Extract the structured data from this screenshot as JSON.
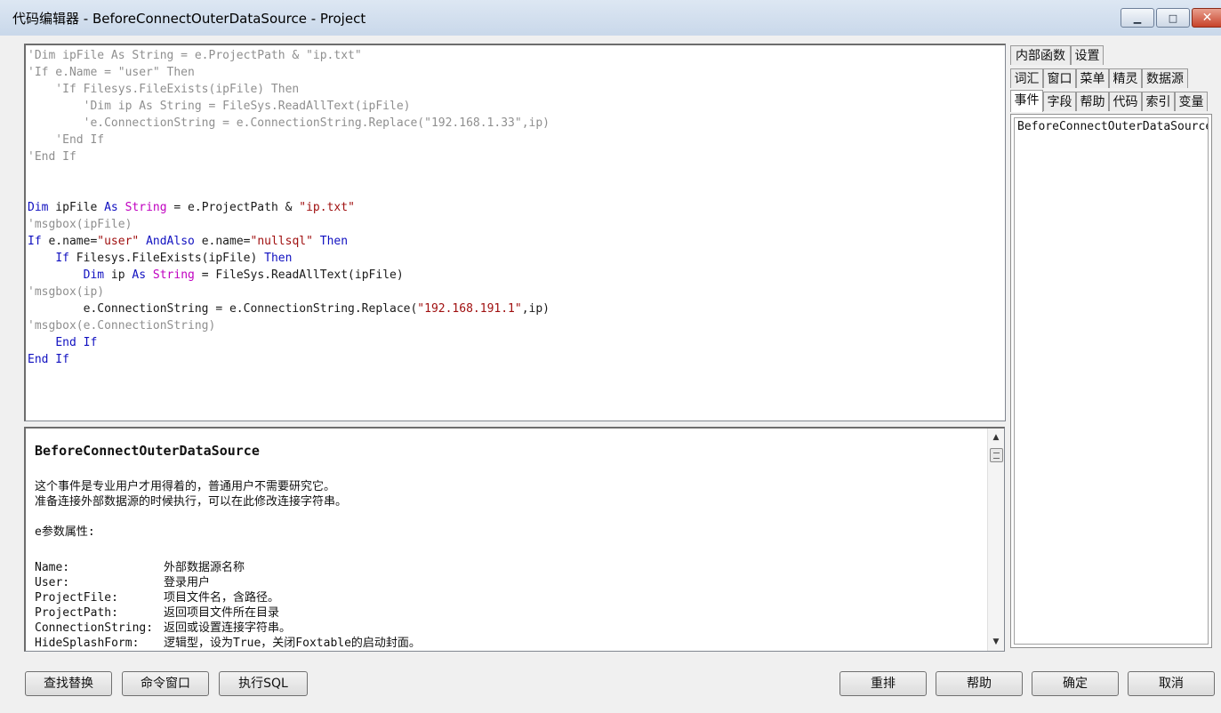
{
  "window": {
    "title": "代码编辑器 - BeforeConnectOuterDataSource - Project",
    "minimize_glyph": "▁",
    "maximize_glyph": "□",
    "close_glyph": "✕"
  },
  "code": [
    [
      [
        "c-cm",
        "'Dim ipFile As String = e.ProjectPath & \"ip.txt\""
      ]
    ],
    [
      [
        "c-cm",
        "'If e.Name = \"user\" Then"
      ]
    ],
    [
      [
        "c-cm",
        "    'If Filesys.FileExists(ipFile) Then"
      ]
    ],
    [
      [
        "c-cm",
        "        'Dim ip As String = FileSys.ReadAllText(ipFile)"
      ]
    ],
    [
      [
        "c-cm",
        "        'e.ConnectionString = e.ConnectionString.Replace(\"192.168.1.33\",ip)"
      ]
    ],
    [
      [
        "c-cm",
        "    'End If"
      ]
    ],
    [
      [
        "c-cm",
        "'End If"
      ]
    ],
    [],
    [],
    [
      [
        "c-kw",
        "Dim"
      ],
      [
        "c-tx",
        " ipFile "
      ],
      [
        "c-kw",
        "As"
      ],
      [
        "c-tx",
        " "
      ],
      [
        "c-ty",
        "String"
      ],
      [
        "c-tx",
        " = e.ProjectPath & "
      ],
      [
        "c-st",
        "\"ip.txt\""
      ]
    ],
    [
      [
        "c-cm",
        "'msgbox(ipFile)"
      ]
    ],
    [
      [
        "c-kw",
        "If"
      ],
      [
        "c-tx",
        " e.name="
      ],
      [
        "c-st",
        "\"user\""
      ],
      [
        "c-tx",
        " "
      ],
      [
        "c-kw",
        "AndAlso"
      ],
      [
        "c-tx",
        " e.name="
      ],
      [
        "c-st",
        "\"nullsql\""
      ],
      [
        "c-tx",
        " "
      ],
      [
        "c-kw",
        "Then"
      ]
    ],
    [
      [
        "c-tx",
        "    "
      ],
      [
        "c-kw",
        "If"
      ],
      [
        "c-tx",
        " Filesys.FileExists(ipFile) "
      ],
      [
        "c-kw",
        "Then"
      ]
    ],
    [
      [
        "c-tx",
        "        "
      ],
      [
        "c-kw",
        "Dim"
      ],
      [
        "c-tx",
        " ip "
      ],
      [
        "c-kw",
        "As"
      ],
      [
        "c-tx",
        " "
      ],
      [
        "c-ty",
        "String"
      ],
      [
        "c-tx",
        " = FileSys.ReadAllText(ipFile)"
      ]
    ],
    [
      [
        "c-cm",
        "'msgbox(ip)"
      ]
    ],
    [
      [
        "c-tx",
        "        e.ConnectionString = e.ConnectionString.Replace("
      ],
      [
        "c-st",
        "\"192.168.191.1\""
      ],
      [
        "c-tx",
        ",ip)"
      ]
    ],
    [
      [
        "c-cm",
        "'msgbox(e.ConnectionString)"
      ]
    ],
    [
      [
        "c-tx",
        "    "
      ],
      [
        "c-kw",
        "End If"
      ]
    ],
    [
      [
        "c-kw",
        "End If"
      ]
    ]
  ],
  "help": {
    "title": "BeforeConnectOuterDataSource",
    "desc1": "这个事件是专业用户才用得着的，普通用户不需要研究它。",
    "desc2": "准备连接外部数据源的时候执行，可以在此修改连接字符串。",
    "params_heading": "e参数属性:",
    "params": [
      {
        "name": "Name:",
        "desc": "外部数据源名称"
      },
      {
        "name": "User:",
        "desc": "登录用户"
      },
      {
        "name": "ProjectFile:",
        "desc": "项目文件名，含路径。"
      },
      {
        "name": "ProjectPath:",
        "desc": "返回项目文件所在目录"
      },
      {
        "name": "ConnectionString:",
        "desc": "返回或设置连接字符串。"
      },
      {
        "name": "HideSplashForm:",
        "desc": "逻辑型，设为True，关闭Foxtable的启动封面。"
      }
    ],
    "scroll_up": "▲",
    "scroll_down": "▼"
  },
  "side_tabs": {
    "row1": [
      "内部函数",
      "设置"
    ],
    "row2": [
      "词汇",
      "窗口",
      "菜单",
      "精灵",
      "数据源"
    ],
    "row3": [
      "事件",
      "字段",
      "帮助",
      "代码",
      "索引",
      "变量"
    ],
    "active": "事件"
  },
  "event_list": [
    "BeforeConnectOuterDataSource"
  ],
  "buttons": {
    "find_replace": "查找替换",
    "command_window": "命令窗口",
    "execute_sql": "执行SQL",
    "rearrange": "重排",
    "help": "帮助",
    "ok": "确定",
    "cancel": "取消"
  }
}
